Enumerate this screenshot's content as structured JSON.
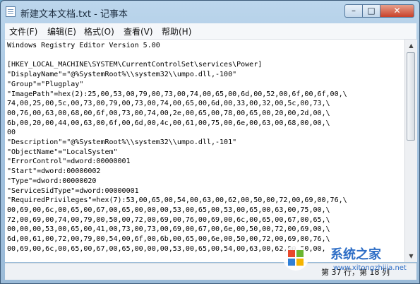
{
  "window": {
    "title": "新建文本文档.txt - 记事本",
    "buttons": {
      "minimize": "–",
      "maximize": "□",
      "close": "✕"
    }
  },
  "menu": [
    {
      "label": "文件(F)"
    },
    {
      "label": "编辑(E)"
    },
    {
      "label": "格式(O)"
    },
    {
      "label": "查看(V)"
    },
    {
      "label": "帮助(H)"
    }
  ],
  "editor": {
    "lines": [
      "Windows Registry Editor Version 5.00",
      "",
      "[HKEY_LOCAL_MACHINE\\SYSTEM\\CurrentControlSet\\services\\Power]",
      "\"DisplayName\"=\"@%SystemRoot%\\\\system32\\\\umpo.dll,-100\"",
      "\"Group\"=\"Plugplay\"",
      "\"ImagePath\"=hex(2):25,00,53,00,79,00,73,00,74,00,65,00,6d,00,52,00,6f,00,6f,00,\\",
      "74,00,25,00,5c,00,73,00,79,00,73,00,74,00,65,00,6d,00,33,00,32,00,5c,00,73,\\",
      "00,76,00,63,00,68,00,6f,00,73,00,74,00,2e,00,65,00,78,00,65,00,20,00,2d,00,\\",
      "6b,00,20,00,44,00,63,00,6f,00,6d,00,4c,00,61,00,75,00,6e,00,63,00,68,00,00,\\",
      "00",
      "\"Description\"=\"@%SystemRoot%\\\\system32\\\\umpo.dll,-101\"",
      "\"ObjectName\"=\"LocalSystem\"",
      "\"ErrorControl\"=dword:00000001",
      "\"Start\"=dword:00000002",
      "\"Type\"=dword:00000020",
      "\"ServiceSidType\"=dword:00000001",
      "\"RequiredPrivileges\"=hex(7):53,00,65,00,54,00,63,00,62,00,50,00,72,00,69,00,76,\\",
      "00,69,00,6c,00,65,00,67,00,65,00,00,00,53,00,65,00,53,00,65,00,63,00,75,00,\\",
      "72,00,69,00,74,00,79,00,50,00,72,00,69,00,76,00,69,00,6c,00,65,00,67,00,65,\\",
      "00,00,00,53,00,65,00,41,00,73,00,73,00,69,00,67,00,6e,00,50,00,72,00,69,00,\\",
      "6d,00,61,00,72,00,79,00,54,00,6f,00,6b,00,65,00,6e,00,50,00,72,00,69,00,76,\\",
      "00,69,00,6c,00,65,00,67,00,65,00,00,00,53,00,65,00,54,00,63,00,62,00,50,00,"
    ]
  },
  "status": {
    "position": "第 37 行，第 18 列"
  },
  "watermark": {
    "text": "系统之家",
    "url": "www.xitongzhijia.net"
  }
}
